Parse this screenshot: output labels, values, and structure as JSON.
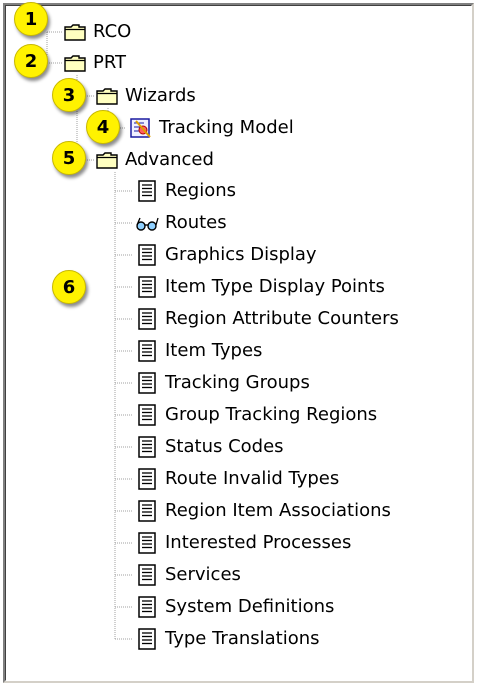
{
  "tree": {
    "nodes": [
      {
        "label": "RCO",
        "icon": "folder-icon"
      },
      {
        "label": "PRT",
        "icon": "folder-icon"
      },
      {
        "label": "Wizards",
        "icon": "folder-icon"
      },
      {
        "label": "Tracking Model",
        "icon": "wizard-icon"
      },
      {
        "label": "Advanced",
        "icon": "folder-icon"
      },
      {
        "label": "Regions",
        "icon": "document-icon"
      },
      {
        "label": "Routes",
        "icon": "glasses-icon"
      },
      {
        "label": "Graphics Display",
        "icon": "document-icon"
      },
      {
        "label": "Item Type Display Points",
        "icon": "document-icon"
      },
      {
        "label": "Region Attribute Counters",
        "icon": "document-icon"
      },
      {
        "label": "Item Types",
        "icon": "document-icon"
      },
      {
        "label": "Tracking Groups",
        "icon": "document-icon"
      },
      {
        "label": "Group Tracking Regions",
        "icon": "document-icon"
      },
      {
        "label": "Status Codes",
        "icon": "document-icon"
      },
      {
        "label": "Route Invalid Types",
        "icon": "document-icon"
      },
      {
        "label": "Region Item Associations",
        "icon": "document-icon"
      },
      {
        "label": "Interested Processes",
        "icon": "document-icon"
      },
      {
        "label": "Services",
        "icon": "document-icon"
      },
      {
        "label": "System Definitions",
        "icon": "document-icon"
      },
      {
        "label": "Type Translations",
        "icon": "document-icon"
      }
    ]
  },
  "callouts": [
    "1",
    "2",
    "3",
    "4",
    "5",
    "6"
  ],
  "colors": {
    "callout": "#fff200",
    "folder": "#ffffc0",
    "tree_line": "#a0a0a0"
  }
}
